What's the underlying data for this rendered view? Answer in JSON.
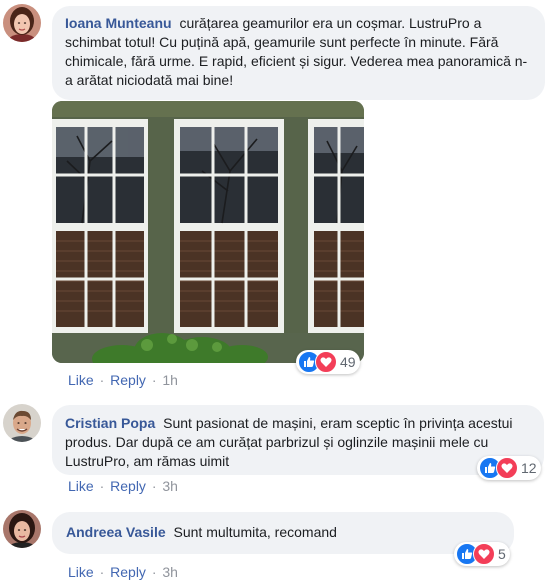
{
  "comments": [
    {
      "author": "Ioana Munteanu",
      "text": "curățarea geamurilor era un coșmar. LustruPro a schimbat totul! Cu puțină apă, geamurile sunt perfecte în minute. Fără chimicale, fără urme. E rapid, eficient și sigur. Vederea mea panoramică n-a arătat niciodată mai bine!",
      "reactions": "49",
      "like_label": "Like",
      "reply_label": "Reply",
      "time": "1h"
    },
    {
      "author": "Cristian Popa",
      "text": "Sunt pasionat de mașini, eram sceptic în privința acestui produs. Dar după ce am curățat parbrizul și oglinzile mașinii mele cu LustruPro, am rămas uimit",
      "reactions": "12",
      "like_label": "Like",
      "reply_label": "Reply",
      "time": "3h"
    },
    {
      "author": "Andreea Vasile",
      "text": "Sunt multumita, recomand",
      "reactions": "5",
      "like_label": "Like",
      "reply_label": "Reply",
      "time": "3h"
    }
  ],
  "colors": {
    "author": "#385898",
    "link": "#4267b2",
    "bubble": "#f0f2f5",
    "like_reaction": "#1877f2",
    "love_reaction": "#f33e58"
  },
  "icons": [
    "like-reaction-icon",
    "love-reaction-icon"
  ]
}
